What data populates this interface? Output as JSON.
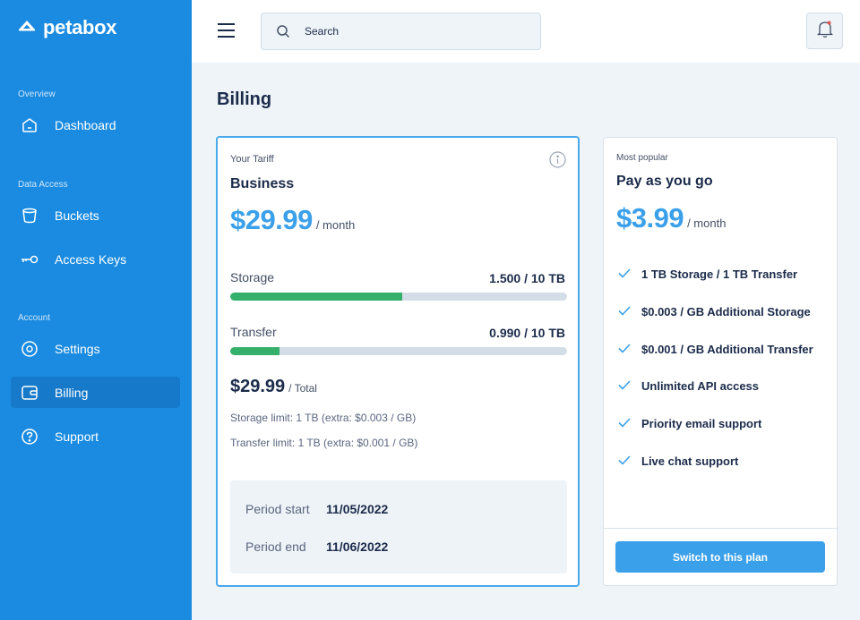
{
  "app": {
    "name": "petabox"
  },
  "sidebar": {
    "sections": [
      {
        "title": "Overview"
      },
      {
        "title": "Data Access"
      },
      {
        "title": "Account"
      }
    ],
    "items": [
      {
        "label": "Dashboard",
        "icon": "home-icon"
      },
      {
        "label": "Buckets",
        "icon": "bucket-icon"
      },
      {
        "label": "Access Keys",
        "icon": "key-icon"
      },
      {
        "label": "Settings",
        "icon": "gear-icon"
      },
      {
        "label": "Billing",
        "icon": "wallet-icon",
        "active": true
      },
      {
        "label": "Support",
        "icon": "help-icon"
      }
    ]
  },
  "header": {
    "search_placeholder": "Search"
  },
  "page": {
    "title": "Billing"
  },
  "tariff": {
    "label": "Your Tariff",
    "plan": "Business",
    "price": "$29.99",
    "per": "/ month",
    "storage": {
      "label": "Storage",
      "value": "1.500 / 10 TB",
      "fill_fraction": 0.51
    },
    "transfer": {
      "label": "Transfer",
      "value": "0.990 / 10 TB",
      "fill_fraction": 0.146
    },
    "total": {
      "amount": "$29.99",
      "per": "/ Total"
    },
    "storage_limit": "Storage limit:  1 TB (extra: $0.003 / GB)",
    "transfer_limit": "Transfer limit: 1 TB (extra: $0.001 / GB)",
    "period_start": {
      "label": "Period start",
      "value": "11/05/2022"
    },
    "period_end": {
      "label": "Period end",
      "value": "11/06/2022"
    }
  },
  "popular": {
    "label": "Most popular",
    "plan": "Pay as you go",
    "price": "$3.99",
    "per": "/ month",
    "features": [
      "1 TB Storage / 1 TB Transfer",
      "$0.003 / GB Additional Storage",
      "$0.001 / GB Additional Transfer",
      "Unlimited API access",
      "Priority email support",
      "Live chat support"
    ],
    "button": "Switch to this plan"
  },
  "colors": {
    "sidebar_bg": "#1a8be0",
    "accent": "#3ba0ea",
    "progress_fill": "#34b06a",
    "notification_dot": "#e25555"
  }
}
